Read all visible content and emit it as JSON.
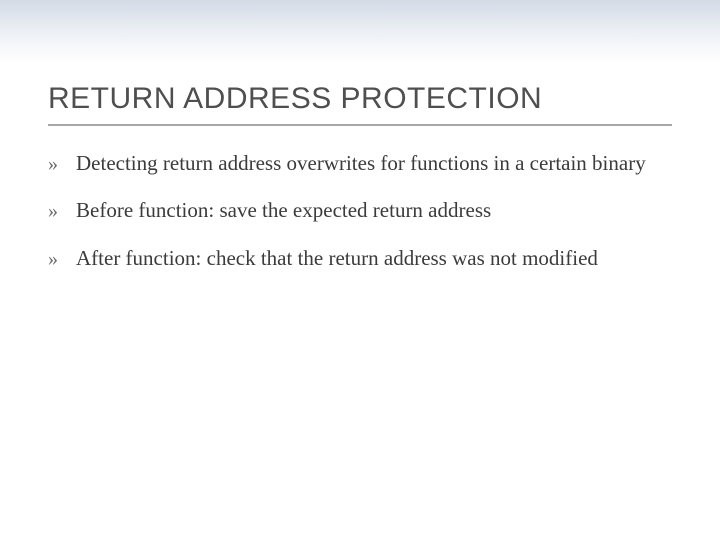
{
  "title": "RETURN ADDRESS PROTECTION",
  "bullet_glyph": "»",
  "items": [
    "Detecting return address overwrites for functions in a certain binary",
    "Before function: save the expected return address",
    "After function: check that the return address was not modified"
  ]
}
